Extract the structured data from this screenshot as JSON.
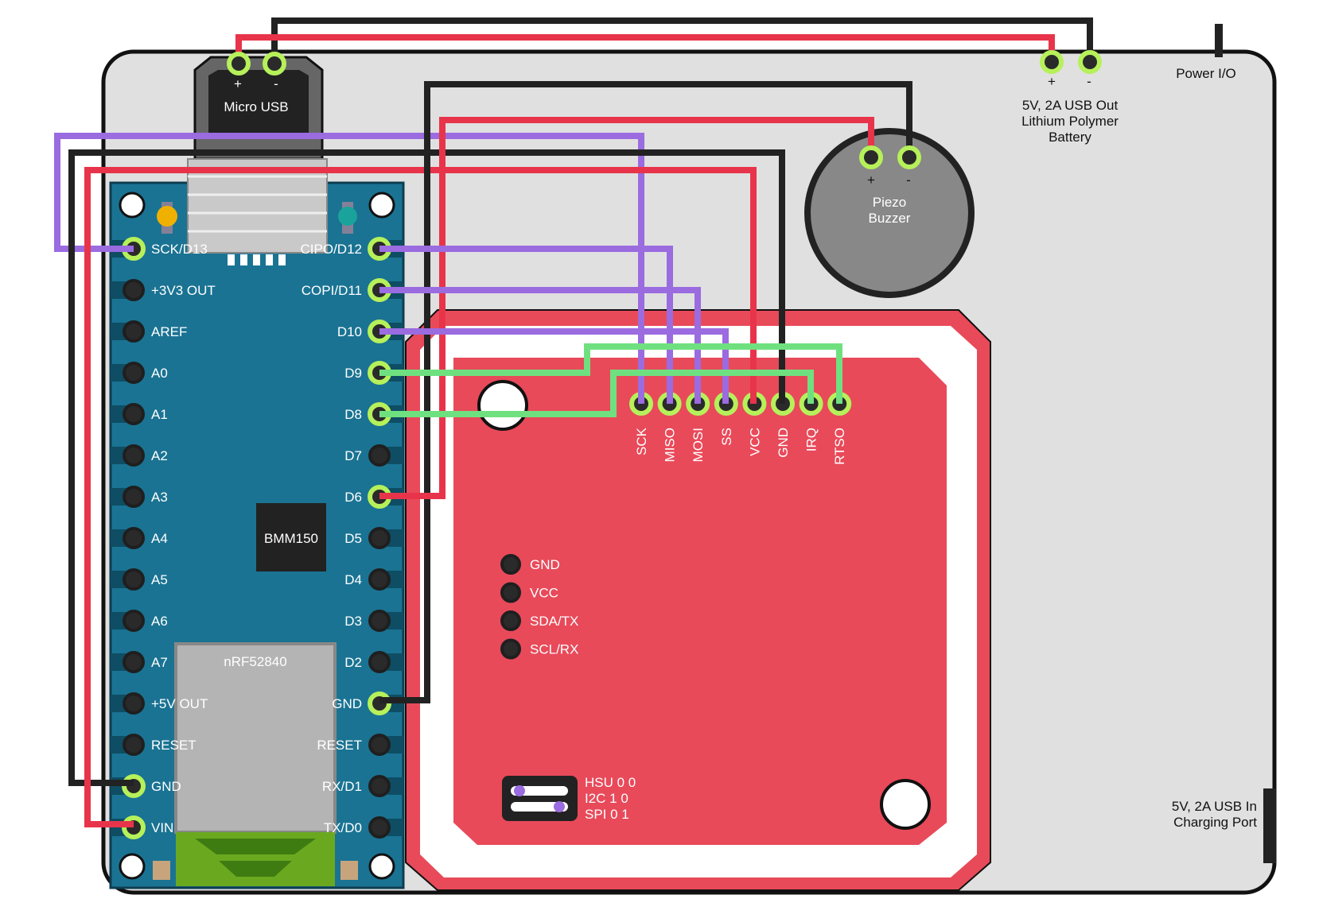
{
  "colors": {
    "board_blue": "#1a7393",
    "wire_red": "#e8344a",
    "wire_black": "#222222",
    "wire_purple": "#9b6be0",
    "wire_green": "#6fe07f",
    "nfc_red": "#e84a5a",
    "case_gray": "#e0e0e0",
    "pin_ring": "#b6f05a"
  },
  "case": {
    "power_switch_label": "Power I/O",
    "charging_port_label_1": "5V, 2A USB In",
    "charging_port_label_2": "Charging Port"
  },
  "battery": {
    "label_1": "5V, 2A USB Out",
    "label_2": "Lithium Polymer",
    "label_3": "Battery",
    "plus": "+",
    "minus": "-"
  },
  "usb": {
    "label": "Micro USB",
    "plus": "+",
    "minus": "-"
  },
  "buzzer": {
    "label_1": "Piezo",
    "label_2": "Buzzer",
    "plus": "+",
    "minus": "-"
  },
  "arduino": {
    "left_pins": [
      "SCK/D13",
      "+3V3 OUT",
      "AREF",
      "A0",
      "A1",
      "A2",
      "A3",
      "A4",
      "A5",
      "A6",
      "A7",
      "+5V OUT",
      "RESET",
      "GND",
      "VIN"
    ],
    "right_pins": [
      "CIPO/D12",
      "COPI/D11",
      "D10",
      "D9",
      "D8",
      "D7",
      "D6",
      "D5",
      "D4",
      "D3",
      "D2",
      "GND",
      "RESET",
      "RX/D1",
      "TX/D0"
    ],
    "sensor_chip": "BMM150",
    "radio_module": "nRF52840"
  },
  "nfc": {
    "header_pins": [
      "SCK",
      "MISO",
      "MOSI",
      "SS",
      "VCC",
      "GND",
      "IRQ",
      "RTSO"
    ],
    "i2c_pins": [
      "GND",
      "VCC",
      "SDA/TX",
      "SCL/RX"
    ],
    "mode_table": [
      "HSU 0 0",
      "I2C  1 0",
      "SPI  0 1"
    ]
  }
}
